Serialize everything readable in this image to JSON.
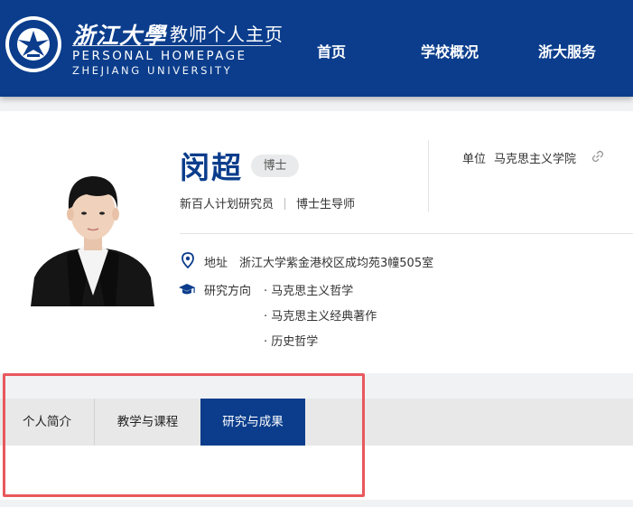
{
  "header": {
    "logo_cn": "浙江大學",
    "logo_sub": "教师个人主页",
    "logo_en_line1": "PERSONAL HOMEPAGE",
    "logo_en_line2": "ZHEJIANG UNIVERSITY",
    "brand_color": "#0b3d8c",
    "nav": [
      {
        "label": "首页"
      },
      {
        "label": "学校概况"
      },
      {
        "label": "浙大服务"
      }
    ]
  },
  "profile": {
    "name": "闵超",
    "degree": "博士",
    "titles": [
      "新百人计划研究员",
      "博士生导师"
    ],
    "unit_label": "单位",
    "unit_value": "马克思主义学院",
    "address_label": "地址",
    "address_value": "浙江大学紫金港校区成均苑3幢505室",
    "research_label": "研究方向",
    "research_items": [
      "· 马克思主义哲学",
      "· 马克思主义经典著作",
      "· 历史哲学"
    ]
  },
  "tabs": [
    {
      "label": "个人简介",
      "active": false
    },
    {
      "label": "教学与课程",
      "active": false
    },
    {
      "label": "研究与成果",
      "active": true
    }
  ],
  "icons": {
    "logo": "zju-emblem-icon",
    "unit_link": "link-icon",
    "address": "location-pin-icon",
    "research": "graduation-cap-icon"
  },
  "highlight_color": "#e8585d"
}
